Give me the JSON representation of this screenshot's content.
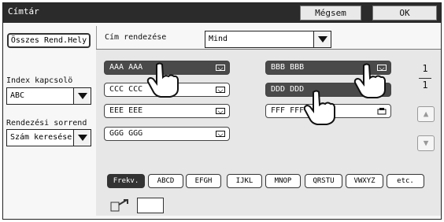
{
  "window": {
    "title": "Címtár"
  },
  "toolbar": {
    "cancel_label": "Mégsem",
    "ok_label": "OK"
  },
  "sidebar": {
    "all_locations_label": "Összes Rend.Hely",
    "index_label": "Index kapcsolö",
    "index_value": "ABC",
    "sort_label": "Rendezési sorrend",
    "sort_value": "Szám keresése"
  },
  "address_sort": {
    "label": "Cím rendezése",
    "value": "Mind"
  },
  "entries": [
    {
      "name": "AAA AAA",
      "selected": true,
      "icon": "mail-icon"
    },
    {
      "name": "BBB BBB",
      "selected": true,
      "icon": "mail-icon"
    },
    {
      "name": "CCC CCC",
      "selected": false,
      "icon": "mail-icon"
    },
    {
      "name": "DDD DDD",
      "selected": true,
      "icon": "none"
    },
    {
      "name": "EEE EEE",
      "selected": false,
      "icon": "mail-icon"
    },
    {
      "name": "FFF FFF",
      "selected": false,
      "icon": "fax-icon"
    },
    {
      "name": "GGG GGG",
      "selected": false,
      "icon": "mail-icon"
    }
  ],
  "pagination": {
    "current": "1",
    "total": "1",
    "up": "▲",
    "down": "▼"
  },
  "tabs": [
    "Frekv.",
    "ABCD",
    "EFGH",
    "IJKL",
    "MNOP",
    "QRSTU",
    "VWXYZ",
    "etc."
  ],
  "colors": {
    "titlebar": "#2b2b2b",
    "selected_entry": "#4a4a4a",
    "panel": "#e7e7e7"
  }
}
